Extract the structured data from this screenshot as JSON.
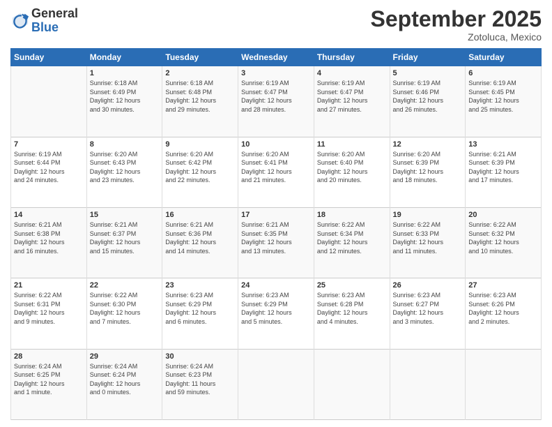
{
  "header": {
    "logo_general": "General",
    "logo_blue": "Blue",
    "month_title": "September 2025",
    "location": "Zotoluca, Mexico"
  },
  "days_of_week": [
    "Sunday",
    "Monday",
    "Tuesday",
    "Wednesday",
    "Thursday",
    "Friday",
    "Saturday"
  ],
  "weeks": [
    [
      {
        "day": "",
        "content": ""
      },
      {
        "day": "1",
        "content": "Sunrise: 6:18 AM\nSunset: 6:49 PM\nDaylight: 12 hours\nand 30 minutes."
      },
      {
        "day": "2",
        "content": "Sunrise: 6:18 AM\nSunset: 6:48 PM\nDaylight: 12 hours\nand 29 minutes."
      },
      {
        "day": "3",
        "content": "Sunrise: 6:19 AM\nSunset: 6:47 PM\nDaylight: 12 hours\nand 28 minutes."
      },
      {
        "day": "4",
        "content": "Sunrise: 6:19 AM\nSunset: 6:47 PM\nDaylight: 12 hours\nand 27 minutes."
      },
      {
        "day": "5",
        "content": "Sunrise: 6:19 AM\nSunset: 6:46 PM\nDaylight: 12 hours\nand 26 minutes."
      },
      {
        "day": "6",
        "content": "Sunrise: 6:19 AM\nSunset: 6:45 PM\nDaylight: 12 hours\nand 25 minutes."
      }
    ],
    [
      {
        "day": "7",
        "content": "Sunrise: 6:19 AM\nSunset: 6:44 PM\nDaylight: 12 hours\nand 24 minutes."
      },
      {
        "day": "8",
        "content": "Sunrise: 6:20 AM\nSunset: 6:43 PM\nDaylight: 12 hours\nand 23 minutes."
      },
      {
        "day": "9",
        "content": "Sunrise: 6:20 AM\nSunset: 6:42 PM\nDaylight: 12 hours\nand 22 minutes."
      },
      {
        "day": "10",
        "content": "Sunrise: 6:20 AM\nSunset: 6:41 PM\nDaylight: 12 hours\nand 21 minutes."
      },
      {
        "day": "11",
        "content": "Sunrise: 6:20 AM\nSunset: 6:40 PM\nDaylight: 12 hours\nand 20 minutes."
      },
      {
        "day": "12",
        "content": "Sunrise: 6:20 AM\nSunset: 6:39 PM\nDaylight: 12 hours\nand 18 minutes."
      },
      {
        "day": "13",
        "content": "Sunrise: 6:21 AM\nSunset: 6:39 PM\nDaylight: 12 hours\nand 17 minutes."
      }
    ],
    [
      {
        "day": "14",
        "content": "Sunrise: 6:21 AM\nSunset: 6:38 PM\nDaylight: 12 hours\nand 16 minutes."
      },
      {
        "day": "15",
        "content": "Sunrise: 6:21 AM\nSunset: 6:37 PM\nDaylight: 12 hours\nand 15 minutes."
      },
      {
        "day": "16",
        "content": "Sunrise: 6:21 AM\nSunset: 6:36 PM\nDaylight: 12 hours\nand 14 minutes."
      },
      {
        "day": "17",
        "content": "Sunrise: 6:21 AM\nSunset: 6:35 PM\nDaylight: 12 hours\nand 13 minutes."
      },
      {
        "day": "18",
        "content": "Sunrise: 6:22 AM\nSunset: 6:34 PM\nDaylight: 12 hours\nand 12 minutes."
      },
      {
        "day": "19",
        "content": "Sunrise: 6:22 AM\nSunset: 6:33 PM\nDaylight: 12 hours\nand 11 minutes."
      },
      {
        "day": "20",
        "content": "Sunrise: 6:22 AM\nSunset: 6:32 PM\nDaylight: 12 hours\nand 10 minutes."
      }
    ],
    [
      {
        "day": "21",
        "content": "Sunrise: 6:22 AM\nSunset: 6:31 PM\nDaylight: 12 hours\nand 9 minutes."
      },
      {
        "day": "22",
        "content": "Sunrise: 6:22 AM\nSunset: 6:30 PM\nDaylight: 12 hours\nand 7 minutes."
      },
      {
        "day": "23",
        "content": "Sunrise: 6:23 AM\nSunset: 6:29 PM\nDaylight: 12 hours\nand 6 minutes."
      },
      {
        "day": "24",
        "content": "Sunrise: 6:23 AM\nSunset: 6:29 PM\nDaylight: 12 hours\nand 5 minutes."
      },
      {
        "day": "25",
        "content": "Sunrise: 6:23 AM\nSunset: 6:28 PM\nDaylight: 12 hours\nand 4 minutes."
      },
      {
        "day": "26",
        "content": "Sunrise: 6:23 AM\nSunset: 6:27 PM\nDaylight: 12 hours\nand 3 minutes."
      },
      {
        "day": "27",
        "content": "Sunrise: 6:23 AM\nSunset: 6:26 PM\nDaylight: 12 hours\nand 2 minutes."
      }
    ],
    [
      {
        "day": "28",
        "content": "Sunrise: 6:24 AM\nSunset: 6:25 PM\nDaylight: 12 hours\nand 1 minute."
      },
      {
        "day": "29",
        "content": "Sunrise: 6:24 AM\nSunset: 6:24 PM\nDaylight: 12 hours\nand 0 minutes."
      },
      {
        "day": "30",
        "content": "Sunrise: 6:24 AM\nSunset: 6:23 PM\nDaylight: 11 hours\nand 59 minutes."
      },
      {
        "day": "",
        "content": ""
      },
      {
        "day": "",
        "content": ""
      },
      {
        "day": "",
        "content": ""
      },
      {
        "day": "",
        "content": ""
      }
    ]
  ]
}
